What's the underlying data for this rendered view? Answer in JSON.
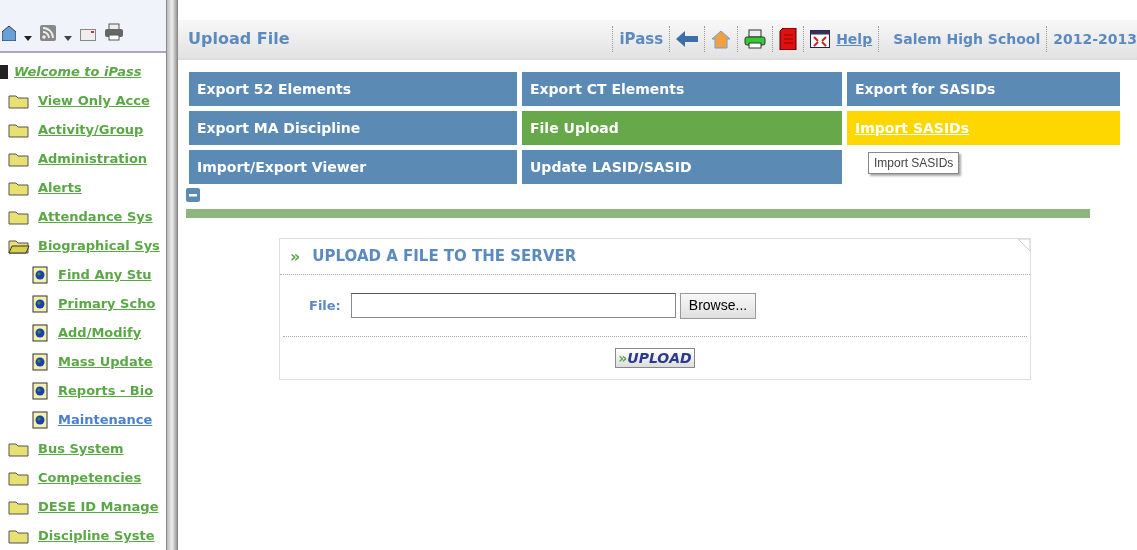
{
  "sidebar": {
    "welcome": "Welcome to iPass",
    "items": [
      {
        "label": "View Only Acce",
        "expanded": false,
        "selected": false
      },
      {
        "label": "Activity/Group",
        "expanded": false,
        "selected": false
      },
      {
        "label": "Administration",
        "expanded": false,
        "selected": false
      },
      {
        "label": "Alerts",
        "expanded": false,
        "selected": false
      },
      {
        "label": "Attendance Sys",
        "expanded": false,
        "selected": false
      },
      {
        "label": "Biographical Sys",
        "expanded": true,
        "selected": false,
        "children": [
          {
            "label": "Find Any Stu",
            "selected": false
          },
          {
            "label": "Primary Scho",
            "selected": false
          },
          {
            "label": "Add/Modify",
            "selected": false
          },
          {
            "label": "Mass Update",
            "selected": false
          },
          {
            "label": "Reports - Bio",
            "selected": false
          },
          {
            "label": "Maintenance",
            "selected": true
          }
        ]
      },
      {
        "label": "Bus System",
        "expanded": false,
        "selected": false
      },
      {
        "label": "Competencies",
        "expanded": false,
        "selected": false
      },
      {
        "label": "DESE ID Manage",
        "expanded": false,
        "selected": false
      },
      {
        "label": "Discipline Syste",
        "expanded": false,
        "selected": false
      }
    ]
  },
  "header": {
    "title": "Upload File",
    "app": "iPass",
    "help": "Help",
    "school": "Salem High School",
    "year": "2012-2013"
  },
  "tiles": [
    {
      "label": "Export 52 Elements",
      "selected": false,
      "hovered": false
    },
    {
      "label": "Export CT Elements",
      "selected": false,
      "hovered": false
    },
    {
      "label": "Export for SASIDs",
      "selected": false,
      "hovered": false
    },
    {
      "label": "Export MA Discipline",
      "selected": false,
      "hovered": false
    },
    {
      "label": "File Upload",
      "selected": true,
      "hovered": false
    },
    {
      "label": "Import SASIDs",
      "selected": false,
      "hovered": true
    },
    {
      "label": "Import/Export Viewer",
      "selected": false,
      "hovered": false
    },
    {
      "label": "Update LASID/SASID",
      "selected": false,
      "hovered": false
    }
  ],
  "tooltip": "Import SASIDs",
  "upload_panel": {
    "marker": "»",
    "title": "UPLOAD A FILE TO THE SERVER",
    "file_label": "File:",
    "browse": "Browse...",
    "upload_marker": "»",
    "upload": "UPLOAD"
  }
}
